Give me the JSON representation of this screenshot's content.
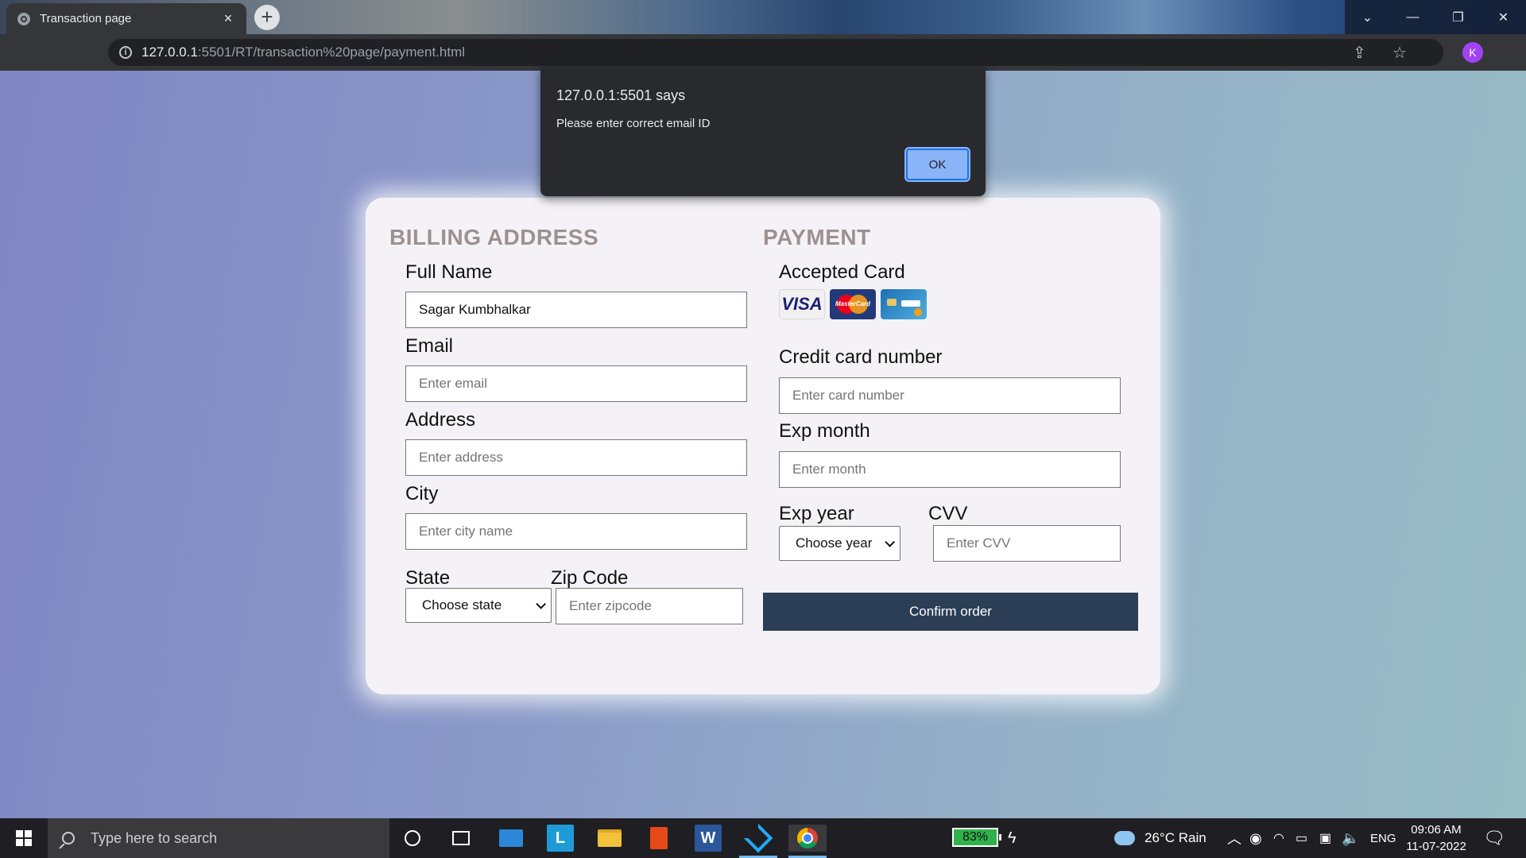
{
  "browser": {
    "tab_title": "Transaction page",
    "tab_close": "×",
    "new_tab": "+",
    "url_host": "127.0.0.1",
    "url_path": ":5501/RT/transaction%20page/payment.html",
    "profile_initial": "K",
    "window_controls": {
      "tabs_list": "⌄",
      "minimize": "—",
      "restore": "❐",
      "close": "✕"
    }
  },
  "dialog": {
    "title": "127.0.0.1:5501 says",
    "message": "Please enter correct email ID",
    "ok_label": "OK"
  },
  "billing": {
    "title": "BILLING ADDRESS",
    "full_name_label": "Full Name",
    "full_name_value": "Sagar Kumbhalkar",
    "email_label": "Email",
    "email_placeholder": "Enter email",
    "address_label": "Address",
    "address_placeholder": "Enter address",
    "city_label": "City",
    "city_placeholder": "Enter city name",
    "state_label": "State",
    "state_selected": "Choose state",
    "zip_label": "Zip Code",
    "zip_placeholder": "Enter zipcode"
  },
  "payment": {
    "title": "PAYMENT",
    "accepted_label": "Accepted Card",
    "visa_text": "VISA",
    "mastercard_text": "MasterCard",
    "card_number_label": "Credit card number",
    "card_number_placeholder": "Enter card number",
    "exp_month_label": "Exp month",
    "exp_month_placeholder": "Enter month",
    "exp_year_label": "Exp year",
    "exp_year_selected": "Choose year",
    "cvv_label": "CVV",
    "cvv_placeholder": "Enter CVV",
    "confirm_label": "Confirm order"
  },
  "taskbar": {
    "search_placeholder": "Type here to search",
    "apps": [
      "cortana-icon",
      "task-view-icon",
      "mail-icon",
      "l-app-icon",
      "file-explorer-icon",
      "office-icon",
      "word-icon",
      "vscode-icon",
      "chrome-icon"
    ],
    "word_letter": "W",
    "l_letter": "L",
    "battery": "83%",
    "weather": "26°C  Rain",
    "language": "ENG",
    "time": "09:06 AM",
    "date": "11-07-2022"
  }
}
